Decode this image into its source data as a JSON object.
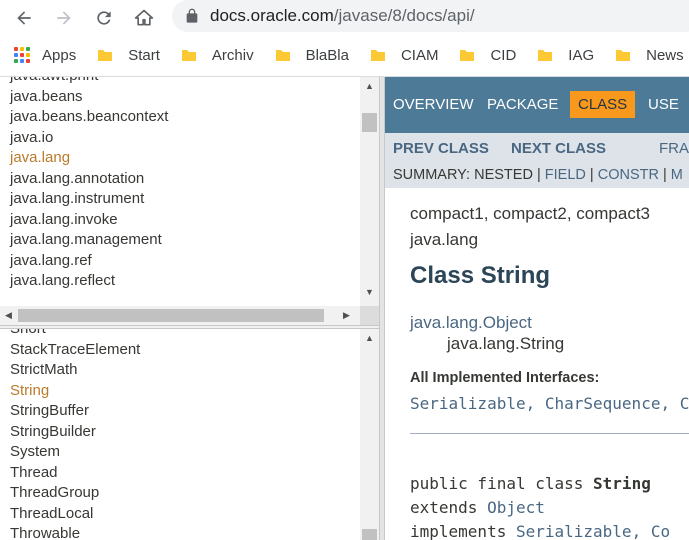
{
  "browser": {
    "url_host": "docs.oracle.com",
    "url_path": "/javase/8/docs/api/"
  },
  "bookmarks": [
    {
      "label": "Apps",
      "icon": "apps-grid-icon"
    },
    {
      "label": "Start",
      "icon": "folder-icon"
    },
    {
      "label": "Archiv",
      "icon": "folder-icon"
    },
    {
      "label": "BlaBla",
      "icon": "folder-icon"
    },
    {
      "label": "CIAM",
      "icon": "folder-icon"
    },
    {
      "label": "CID",
      "icon": "folder-icon"
    },
    {
      "label": "IAG",
      "icon": "folder-icon"
    },
    {
      "label": "News",
      "icon": "folder-icon"
    }
  ],
  "packages_frame": {
    "items": [
      "java.awt.print",
      "java.beans",
      "java.beans.beancontext",
      "java.io",
      "java.lang",
      "java.lang.annotation",
      "java.lang.instrument",
      "java.lang.invoke",
      "java.lang.management",
      "java.lang.ref",
      "java.lang.reflect"
    ],
    "selected_index": 4
  },
  "classes_frame": {
    "items": [
      "Short",
      "StackTraceElement",
      "StrictMath",
      "String",
      "StringBuffer",
      "StringBuilder",
      "System",
      "Thread",
      "ThreadGroup",
      "ThreadLocal",
      "Throwable"
    ],
    "selected_index": 3
  },
  "topnav": {
    "overview": "OVERVIEW",
    "package": "PACKAGE",
    "class": "CLASS",
    "use": "USE"
  },
  "subnav": {
    "prev": "PREV CLASS",
    "next": "NEXT CLASS",
    "frames": "FRA",
    "summary_label": "SUMMARY: NESTED",
    "field": "FIELD",
    "constr": "CONSTR",
    "method_trunc": "M"
  },
  "class_doc": {
    "profiles": "compact1, compact2, compact3",
    "package": "java.lang",
    "title": "Class String",
    "superclass": "java.lang.Object",
    "this_class": "java.lang.String",
    "interfaces_heading": "All Implemented Interfaces:",
    "interfaces": "Serializable, CharSequence, C",
    "decl_prefix": "public final class ",
    "decl_name": "String",
    "extends_kw": "extends ",
    "extends_name": "Object",
    "implements_kw": "implements ",
    "implements_names": "Serializable, Co"
  },
  "colors": {
    "nav_bg": "#4d7a97",
    "nav_active": "#f8981d",
    "subnav_bg": "#dee3e9",
    "link": "#4a6782",
    "selected_pkg": "#bb7a2a",
    "folder": "#fcc934"
  }
}
